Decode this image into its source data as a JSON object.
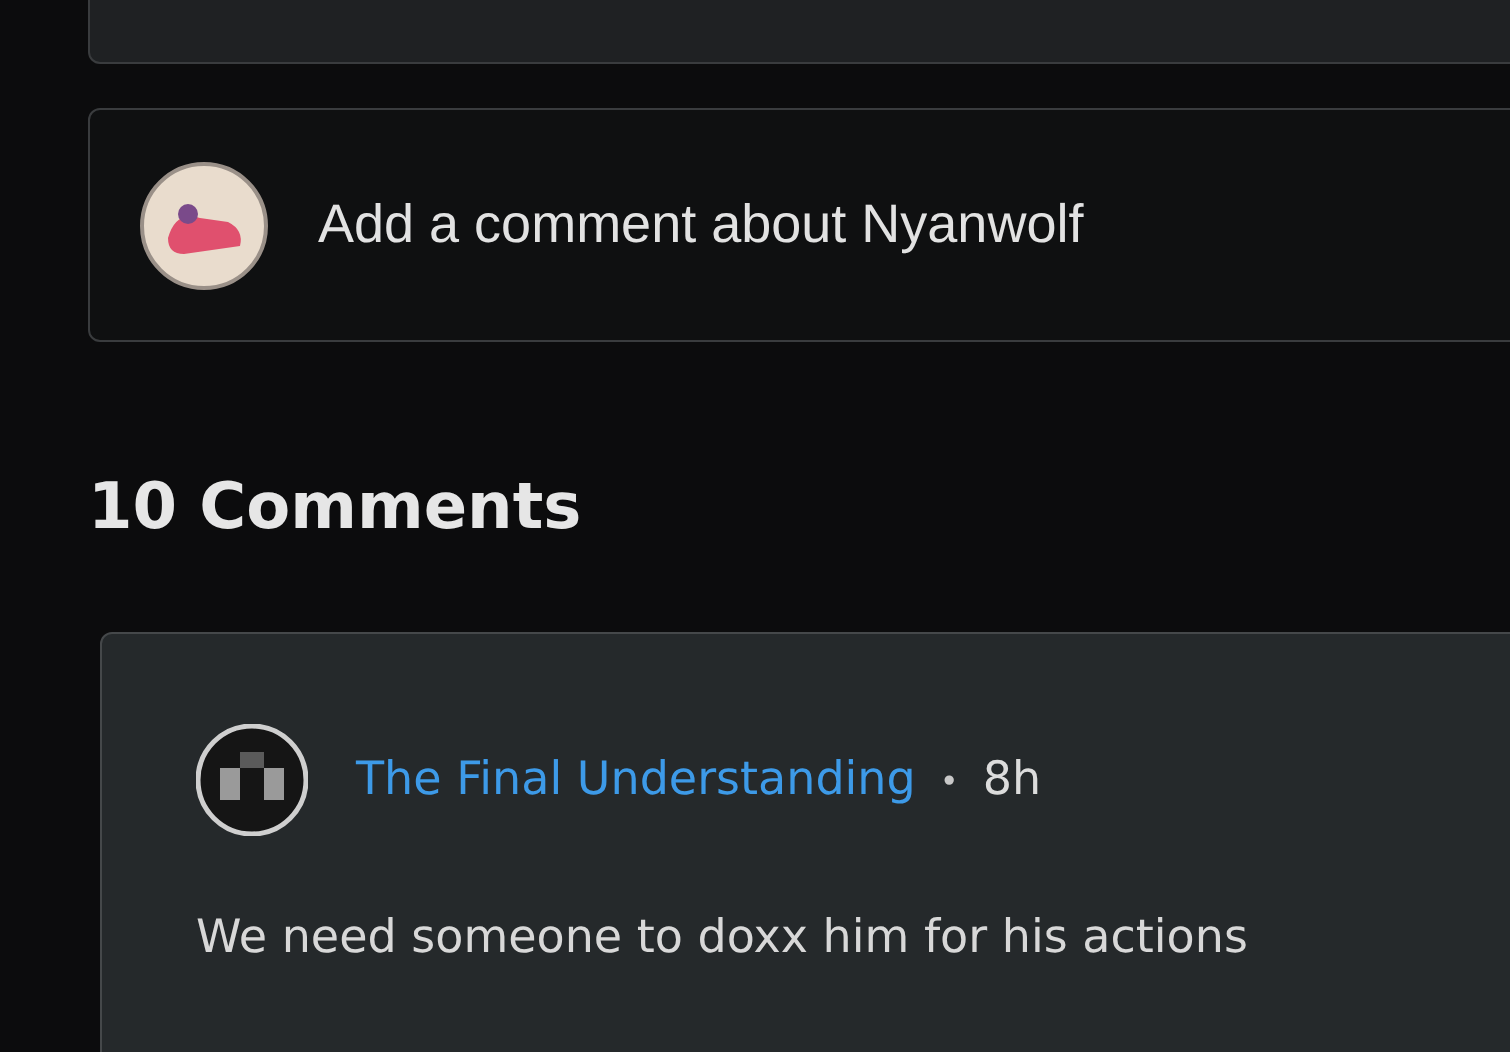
{
  "comment_box": {
    "placeholder": "Add a comment about Nyanwolf"
  },
  "comments_heading": "10 Comments",
  "comments": [
    {
      "author": "The Final Understanding",
      "separator": "•",
      "time": "8h",
      "text": "We need someone to doxx him for his actions"
    }
  ]
}
